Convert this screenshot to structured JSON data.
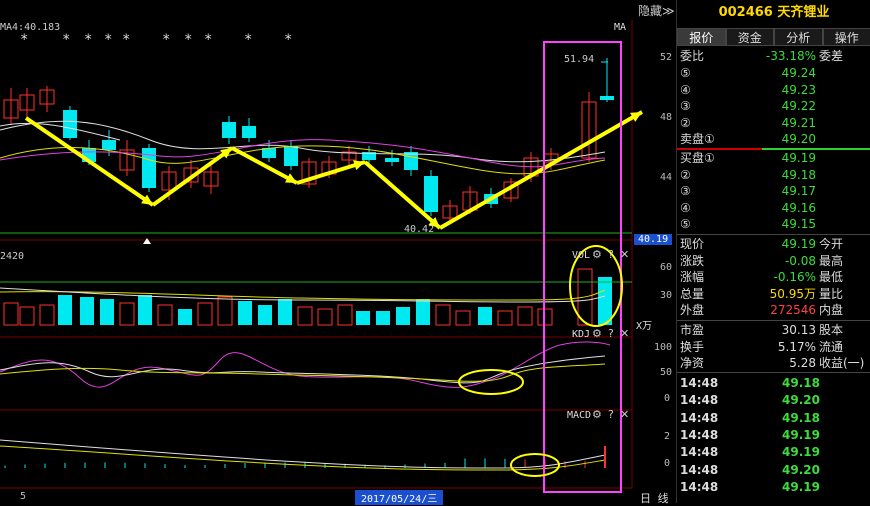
{
  "header": {
    "ma_label": "MA4:40.183",
    "ma_right": "MA",
    "hide_label": "隐藏≫",
    "vol_fragment": "2420"
  },
  "price_axis": [
    "52",
    "48",
    "44"
  ],
  "current_price_tag": "40.19",
  "high_mark": "51.94",
  "low_mark": "40.42",
  "vol_axis": [
    "60",
    "30"
  ],
  "vol_unit": "X万",
  "kdj_axis": [
    "100",
    "50",
    "0"
  ],
  "macd_axis": [
    "2",
    "0"
  ],
  "indicators": {
    "vol": "VOL",
    "kdj": "KDJ",
    "macd": "MACD",
    "gear": "⚙",
    "help": "?",
    "close": "✕"
  },
  "bottom": {
    "left": "5",
    "date": "2017/05/24/三",
    "right": "日 线"
  },
  "stock": {
    "code": "002466",
    "name": "天齐锂业"
  },
  "tabs": [
    {
      "label": "报价",
      "active": true
    },
    {
      "label": "资金",
      "active": false
    },
    {
      "label": "分析",
      "active": false
    },
    {
      "label": "操作",
      "active": false
    }
  ],
  "weibi": {
    "label": "委比",
    "value": "-33.18%",
    "label2": "委差"
  },
  "sell": [
    {
      "label": "⑤",
      "price": "49.24"
    },
    {
      "label": "④",
      "price": "49.23"
    },
    {
      "label": "③",
      "price": "49.22"
    },
    {
      "label": "②",
      "price": "49.21"
    },
    {
      "label": "卖盘①",
      "price": "49.20"
    }
  ],
  "buy": [
    {
      "label": "买盘①",
      "price": "49.19"
    },
    {
      "label": "②",
      "price": "49.18"
    },
    {
      "label": "③",
      "price": "49.17"
    },
    {
      "label": "④",
      "price": "49.16"
    },
    {
      "label": "⑤",
      "price": "49.15"
    }
  ],
  "quote": [
    {
      "l": "现价",
      "v": "49.19",
      "l2": "今开",
      "vc": "g"
    },
    {
      "l": "涨跌",
      "v": "-0.08",
      "l2": "最高",
      "vc": "g"
    },
    {
      "l": "涨幅",
      "v": "-0.16%",
      "l2": "最低",
      "vc": "g"
    },
    {
      "l": "总量",
      "v": "50.95万",
      "l2": "量比",
      "vc": "y"
    },
    {
      "l": "外盘",
      "v": "272546",
      "l2": "内盘",
      "vc": "r"
    }
  ],
  "stats": [
    {
      "l": "市盈",
      "v": "30.13",
      "l2": "股本"
    },
    {
      "l": "换手",
      "v": "5.17%",
      "l2": "流通"
    },
    {
      "l": "净资",
      "v": "5.28",
      "l2": "收益(一)"
    }
  ],
  "trades": [
    {
      "time": "14:48",
      "price": "49.18"
    },
    {
      "time": "14:48",
      "price": "49.20"
    },
    {
      "time": "14:48",
      "price": "49.18"
    },
    {
      "time": "14:48",
      "price": "49.19"
    },
    {
      "time": "14:48",
      "price": "49.19"
    },
    {
      "time": "14:48",
      "price": "49.20"
    },
    {
      "time": "14:48",
      "price": "49.19"
    }
  ],
  "colors": {
    "up": "#ff3030",
    "down": "#00e8f0",
    "arrow": "#ffff00",
    "highlight": "#ff40ff",
    "circle": "#ffff00"
  }
}
